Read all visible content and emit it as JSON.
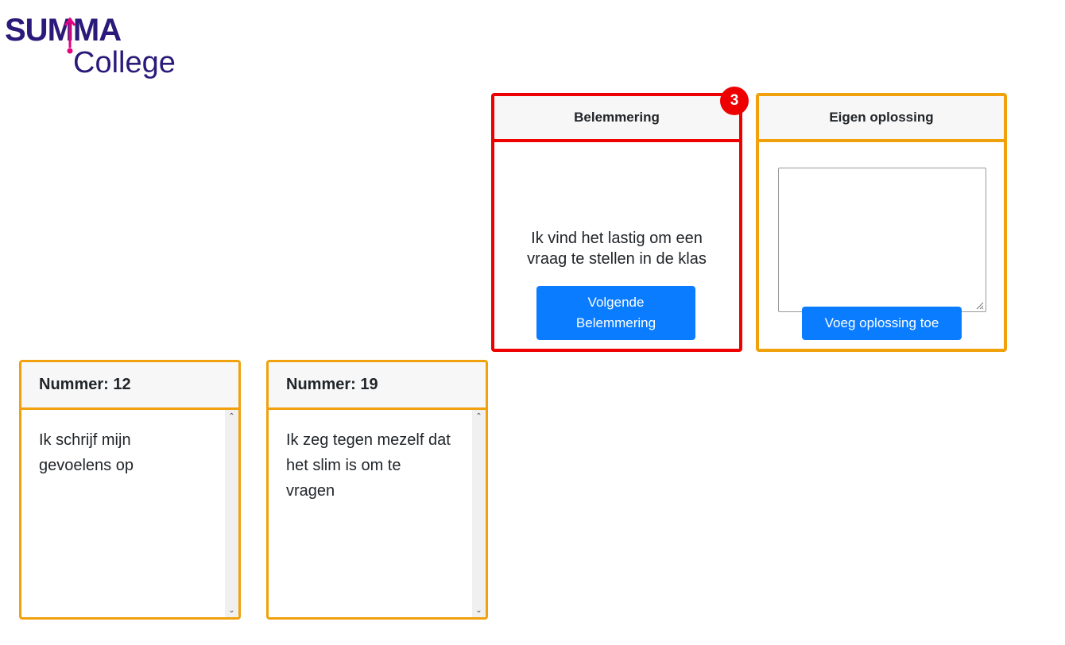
{
  "logo": {
    "line1": "SUMMA",
    "line2": "College",
    "colors": {
      "text": "#2b1a7a",
      "accent": "#e5007e"
    }
  },
  "belemmering": {
    "title": "Belemmering",
    "badge": "3",
    "text": "Ik vind het lastig om een vraag te stellen in de klas",
    "next_button": "Volgende Belemmering",
    "border_color": "#ee0000"
  },
  "eigen_oplossing": {
    "title": "Eigen oplossing",
    "textarea_value": "",
    "add_button": "Voeg oplossing toe",
    "border_color": "#f0a10c"
  },
  "solutions": [
    {
      "title": "Nummer: 12",
      "text": "Ik schrijf mijn gevoelens op"
    },
    {
      "title": "Nummer: 19",
      "text": "Ik zeg tegen mezelf dat het slim is om te vragen"
    }
  ],
  "icons": {
    "scroll_up": "chevron-up-icon",
    "scroll_down": "chevron-down-icon",
    "resize": "resize-grip-icon"
  },
  "colors": {
    "primary_button": "#0a7cff",
    "header_bg": "#f7f7f7"
  }
}
